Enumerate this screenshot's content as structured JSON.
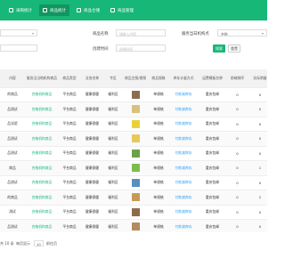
{
  "tabs": [
    {
      "label": "采购统计",
      "active": false
    },
    {
      "label": "商品统计",
      "active": true
    },
    {
      "label": "商品仓储",
      "active": false
    },
    {
      "label": "商品管理",
      "active": false
    }
  ],
  "filters": {
    "name_label": "商品名称",
    "name_placeholder": "请输入内容",
    "sort_label": "服务当日机构点",
    "sort_value": "名称",
    "created_label": "创建时间",
    "created_placeholder": "选择时间",
    "search_btn": "搜索",
    "reset_btn": "重置"
  },
  "table": {
    "headers": [
      "内容",
      "服务当当地机构商品",
      "商品类型",
      "业务名称",
      "专区",
      "商品主图/视频",
      "商品规格",
      "库存计量方式",
      "运费模板名称",
      "前端排序",
      "实际销量"
    ],
    "rows": [
      [
        "的商品",
        "合格机构商品",
        "平台商品",
        "健康保健",
        "福利区",
        "单规格",
        "付款减库存",
        "重庆包邮",
        "0",
        "0"
      ],
      [
        "品测试",
        "合格机构商品",
        "平台商品",
        "健康保健",
        "福利区",
        "单规格",
        "付款减库存",
        "重庆包邮",
        "0",
        "0"
      ],
      [
        "品试验",
        "合格机构商品",
        "平台商品",
        "健康保健",
        "福利区",
        "单规格",
        "付款减库存",
        "重庆包邮",
        "0",
        "0"
      ],
      [
        "品测试",
        "合格机构商品",
        "平台商品",
        "健康保健",
        "福利区",
        "单规格",
        "付款减库存",
        "重庆包邮",
        "0",
        "0"
      ],
      [
        "品测试",
        "合格机构商品",
        "平台商品",
        "健康保健",
        "福利区",
        "单规格",
        "付款减库存",
        "重庆包邮",
        "0",
        "0"
      ],
      [
        "商品",
        "合格机构商品",
        "平台商品",
        "健康保健",
        "福利区",
        "单规格",
        "付款减库存",
        "重庆包邮",
        "0",
        "1"
      ],
      [
        "品测试",
        "合格机构商品",
        "平台商品",
        "健康保健",
        "福利区",
        "单规格",
        "付款减库存",
        "重庆包邮",
        "0",
        "0"
      ],
      [
        "的商品",
        "合格机构商品",
        "平台商品",
        "健康保健",
        "福利区",
        "单规格",
        "付款减库存",
        "重庆包邮",
        "0",
        "2"
      ],
      [
        "测试",
        "合格机构商品",
        "平台商品",
        "健康保健",
        "福利区",
        "单规格",
        "付款减库存",
        "重庆包邮",
        "0",
        "0"
      ],
      [
        "品测试",
        "合格机构商品",
        "平台商品",
        "健康保健",
        "福利区",
        "单规格",
        "付款减库存",
        "重庆包邮",
        "0",
        "0"
      ]
    ],
    "thumb_colors": [
      "#8a6f4e",
      "#d8c27a",
      "#e8d23c",
      "#e7c85a",
      "#6ca049",
      "#7bbd4a",
      "#5a8fbf",
      "#c79a58",
      "#8d6b4a",
      "#b58b5e"
    ]
  },
  "pager": {
    "total": "共 10 条",
    "per_page": "每页显示",
    "size": "10",
    "jump": "前往页"
  }
}
